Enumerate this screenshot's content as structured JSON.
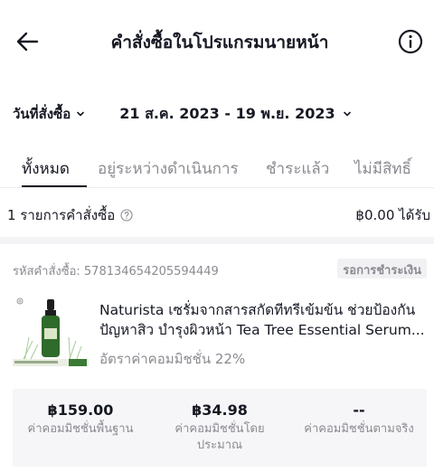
{
  "header": {
    "title": "คำสั่งซื้อในโปรแกรมนายหน้า"
  },
  "filters": {
    "date_label": "วันที่สั่งซื้อ",
    "date_range": "21 ส.ค. 2023 - 19 พ.ย. 2023"
  },
  "tabs": [
    {
      "label": "ทั้งหมด",
      "active": true
    },
    {
      "label": "อยู่ระหว่างดำเนินการ",
      "active": false
    },
    {
      "label": "ชำระแล้ว",
      "active": false
    },
    {
      "label": "ไม่มีสิทธิ์",
      "active": false
    }
  ],
  "summary": {
    "count_text": "1 รายการคำสั่งซื้อ",
    "amount_text": "฿0.00 ได้รับ"
  },
  "order": {
    "id_text": "รหัสคำสั่งซื้อ: 578134654205594449",
    "status": "รอการชำระเงิน",
    "product_title": "Naturista เซรั่มจากสารสกัดทีทรีเข้มข้น ช่วยป้องกันปัญหาสิว บำรุงผิวหน้า Tea Tree Essential Serum...",
    "commission_rate": "อัตราค่าคอมมิชชั่น 22%",
    "earnings": [
      {
        "value": "฿159.00",
        "label": "ค่าคอมมิชชั่นพื้นฐาน"
      },
      {
        "value": "฿34.98",
        "label": "ค่าคอมมิชชั่นโดยประมาณ"
      },
      {
        "value": "--",
        "label": "ค่าคอมมิชชั่นตามจริง"
      }
    ]
  }
}
